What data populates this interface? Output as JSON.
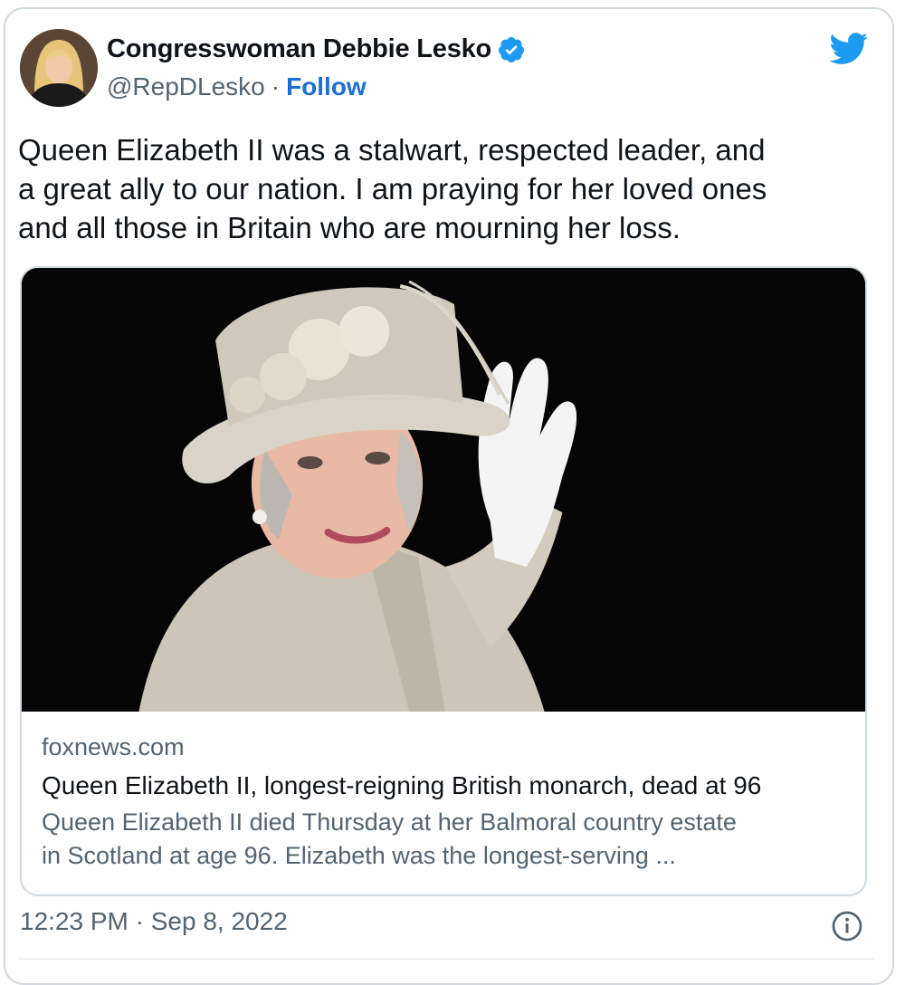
{
  "tweet": {
    "author_name": "Congresswoman Debbie Lesko",
    "handle": "@RepDLesko",
    "separator": "·",
    "follow_label": "Follow",
    "text": "Queen Elizabeth II was a stalwart, respected leader, and\na great ally to our nation. I am praying for her loved ones\nand all those in Britain who are mourning her loss.",
    "timestamp": "12:23 PM · Sep 8, 2022"
  },
  "link_card": {
    "domain": "foxnews.com",
    "headline": "Queen Elizabeth II, longest-reigning British monarch, dead at 96",
    "description": "Queen Elizabeth II died Thursday at her Balmoral country estate\nin Scotland at age 96. Elizabeth was the longest-serving ..."
  },
  "icons": {
    "verified": "verified-badge-icon",
    "brand": "twitter-bird-icon",
    "info": "info-icon"
  },
  "colors": {
    "brand_blue": "#1d9bf0",
    "follow_blue": "#1d6fd6",
    "secondary_text": "#536471",
    "border": "#cfd9de"
  }
}
